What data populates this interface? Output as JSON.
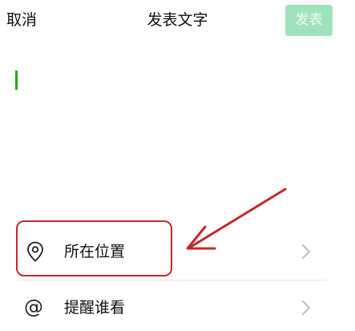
{
  "header": {
    "cancel_label": "取消",
    "title": "发表文字",
    "publish_label": "发表"
  },
  "editor": {
    "value": "",
    "placeholder": ""
  },
  "options": {
    "location_label": "所在位置",
    "mention_label": "提醒谁看",
    "mention_icon": "@"
  },
  "colors": {
    "publish_disabled_bg": "#9fe3be",
    "cursor": "#1aad19",
    "annotation": "#c62828"
  },
  "icons": {
    "location": "location-pin-icon",
    "mention": "at-sign-icon",
    "chevron": "chevron-right-icon"
  }
}
